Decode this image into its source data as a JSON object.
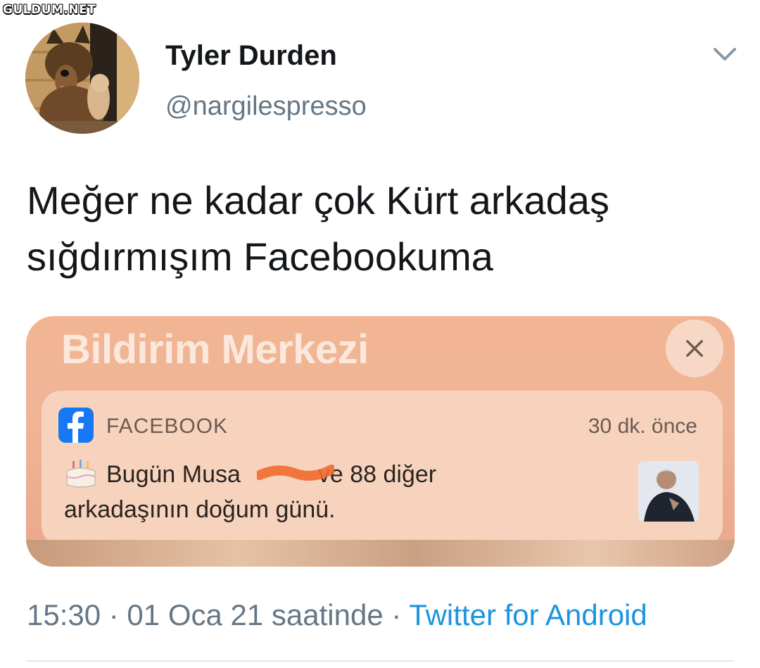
{
  "watermark": "GULDUM.NET",
  "tweet": {
    "author": {
      "display_name": "Tyler Durden",
      "handle": "@nargilespresso"
    },
    "text_lines": [
      "Meğer ne kadar çok Kürt arkadaş",
      "sığdırmışım Facebookuma"
    ],
    "timestamp": "15:30 · 01 Oca 21 saatinde · ",
    "source": "Twitter for Android"
  },
  "media": {
    "notification_center_title": "Bildirim Merkezi",
    "notification": {
      "app_name": "FACEBOOK",
      "time_ago": "30 dk. önce",
      "message_part1": "Bugün Musa",
      "message_part2": "ve 88 diğer",
      "message_line2": "arkadaşının doğum günü."
    }
  },
  "icons": {
    "menu": "chevron-down-icon",
    "close": "close-icon",
    "app": "facebook-logo-icon",
    "birthday": "birthday-cake-icon"
  },
  "colors": {
    "link": "#1b95e0",
    "secondary_text": "#657786",
    "facebook_blue": "#1877f2"
  }
}
